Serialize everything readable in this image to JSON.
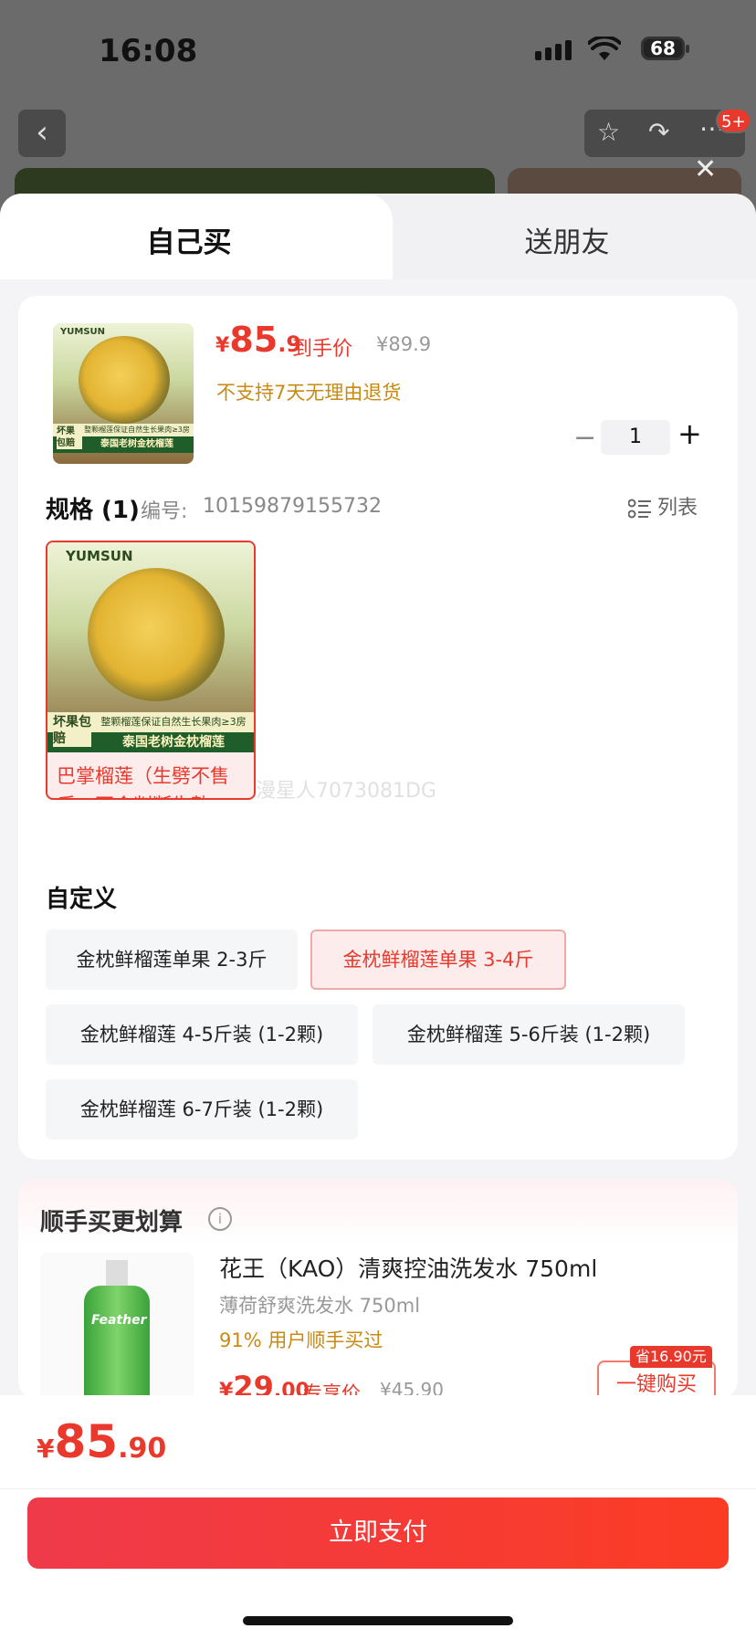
{
  "status": {
    "time": "16:08",
    "battery": "68"
  },
  "topbar": {
    "badge": "5+"
  },
  "tabs": [
    {
      "label": "自己买"
    },
    {
      "label": "送朋友"
    }
  ],
  "product": {
    "brand": "YUMSUN",
    "img_strip1": "整颗榴莲保证自然生长果肉≥3房",
    "img_strip2": "泰国老树金枕榴莲",
    "img_corner": "坏果包赔",
    "price_symbol": "¥",
    "price_int": "85",
    "price_dec": ".9",
    "price_tag": "到手价",
    "orig_price": "¥89.9",
    "no_return": "不支持7天无理由退货",
    "qty": "1"
  },
  "spec": {
    "title": "规格 (1)",
    "code_label": "编号:",
    "code_value": "10159879155732",
    "list_label": "列表",
    "selected_item_line1": "巴掌榴莲（生劈不售",
    "selected_item_line2": "后，不会判断生熟..."
  },
  "watermark": "漫星人7073081DG",
  "custom": {
    "title": "自定义",
    "options": [
      {
        "label": "金枕鲜榴莲单果 2-3斤",
        "selected": false
      },
      {
        "label": "金枕鲜榴莲单果 3-4斤",
        "selected": true
      },
      {
        "label": "金枕鲜榴莲 4-5斤装 (1-2颗)",
        "selected": false
      },
      {
        "label": "金枕鲜榴莲 5-6斤装 (1-2颗)",
        "selected": false
      },
      {
        "label": "金枕鲜榴莲 6-7斤装 (1-2颗)",
        "selected": false
      }
    ]
  },
  "upsell": {
    "title": "顺手买更划算",
    "info_icon": "i",
    "bottle_label": "Feather",
    "name": "花王（KAO）清爽控油洗发水 750ml",
    "sub": "薄荷舒爽洗发水 750ml",
    "pct": "91% 用户顺手买过",
    "price_symbol": "¥",
    "price_int": "29",
    "price_dec": ".00",
    "price_tag": "专享价",
    "orig_price": "¥45.90",
    "save_badge": "省16.90元",
    "button": "一键购买"
  },
  "footer": {
    "total_symbol": "¥",
    "total_int": "85",
    "total_dec": ".90",
    "pay_button": "立即支付"
  },
  "colors": {
    "accent": "#e8392c",
    "warning": "#c88a14"
  }
}
